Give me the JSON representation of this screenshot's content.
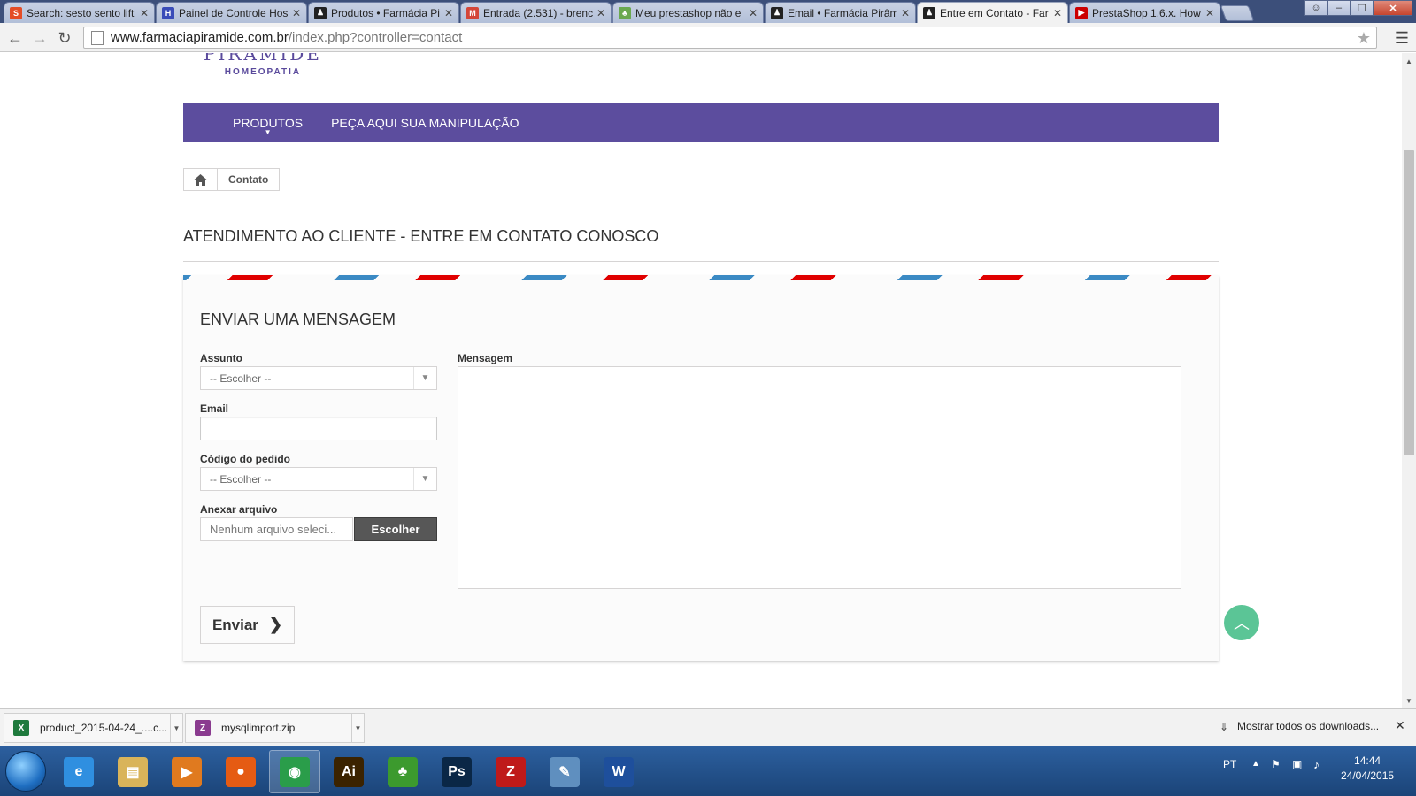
{
  "browser": {
    "tabs": [
      {
        "title": "Search: sesto sento lift",
        "fav_color": "#e44d26",
        "fav_glyph": "S",
        "active": false
      },
      {
        "title": "Painel de Controle Hos",
        "fav_color": "#3a4cb8",
        "fav_glyph": "H",
        "active": false
      },
      {
        "title": "Produtos • Farmácia Pi",
        "fav_color": "#222222",
        "fav_glyph": "♟",
        "active": false
      },
      {
        "title": "Entrada (2.531) - brenc",
        "fav_color": "#d44638",
        "fav_glyph": "M",
        "active": false
      },
      {
        "title": "Meu prestashop não e",
        "fav_color": "#6aa84f",
        "fav_glyph": "♣",
        "active": false
      },
      {
        "title": "Email • Farmácia Pirâm",
        "fav_color": "#222222",
        "fav_glyph": "♟",
        "active": false
      },
      {
        "title": "Entre em Contato - Far",
        "fav_color": "#222222",
        "fav_glyph": "♟",
        "active": true
      },
      {
        "title": "PrestaShop 1.6.x. How",
        "fav_color": "#cc0000",
        "fav_glyph": "▶",
        "active": false
      }
    ],
    "url_host": "www.farmaciapiramide.com.br",
    "url_path": "/index.php?controller=contact"
  },
  "site": {
    "logo_main": "PIRAMIDE",
    "logo_sub": "HOMEOPATIA",
    "nav": [
      {
        "label": "PRODUTOS",
        "has_caret": true
      },
      {
        "label": "PEÇA AQUI SUA MANIPULAÇÃO",
        "has_caret": false
      }
    ],
    "breadcrumb": {
      "current": "Contato"
    },
    "page_heading": "ATENDIMENTO AO CLIENTE - ENTRE EM CONTATO CONOSCO",
    "form": {
      "title": "ENVIAR UMA MENSAGEM",
      "subject_label": "Assunto",
      "subject_value": "-- Escolher --",
      "email_label": "Email",
      "email_value": "",
      "order_label": "Código do pedido",
      "order_value": "-- Escolher --",
      "attach_label": "Anexar arquivo",
      "attach_filename": "Nenhum arquivo seleci...",
      "attach_button": "Escolher",
      "message_label": "Mensagem",
      "message_value": "",
      "send_button": "Enviar"
    },
    "colors": {
      "nav_bg": "#5c4d9e",
      "scroll_top": "#5bc596",
      "stripe_red": "#e00000",
      "stripe_blue": "#3b8ac4"
    }
  },
  "downloads": {
    "items": [
      {
        "name": "product_2015-04-24_....c...",
        "icon_color": "#1f7a3d",
        "icon_glyph": "X"
      },
      {
        "name": "mysqlimport.zip",
        "icon_color": "#8a3b8f",
        "icon_glyph": "Z"
      }
    ],
    "show_all": "Mostrar todos os downloads..."
  },
  "taskbar": {
    "apps": [
      {
        "name": "internet-explorer",
        "glyph": "e",
        "color": "#2f8fe0"
      },
      {
        "name": "file-explorer",
        "glyph": "▤",
        "color": "#d9b45a"
      },
      {
        "name": "media-player",
        "glyph": "▶",
        "color": "#e07a1f"
      },
      {
        "name": "firefox",
        "glyph": "●",
        "color": "#e55b13"
      },
      {
        "name": "chrome",
        "glyph": "◉",
        "color": "#2a9d4a"
      },
      {
        "name": "illustrator",
        "glyph": "Ai",
        "color": "#3b2300"
      },
      {
        "name": "clover",
        "glyph": "♣",
        "color": "#3c9a2e"
      },
      {
        "name": "photoshop",
        "glyph": "Ps",
        "color": "#0a2746"
      },
      {
        "name": "filezilla",
        "glyph": "Z",
        "color": "#bf1a1a"
      },
      {
        "name": "notepad",
        "glyph": "✎",
        "color": "#5f8fbf"
      },
      {
        "name": "word",
        "glyph": "W",
        "color": "#1e4f9c"
      }
    ],
    "lang": "PT",
    "time": "14:44",
    "date": "24/04/2015"
  }
}
